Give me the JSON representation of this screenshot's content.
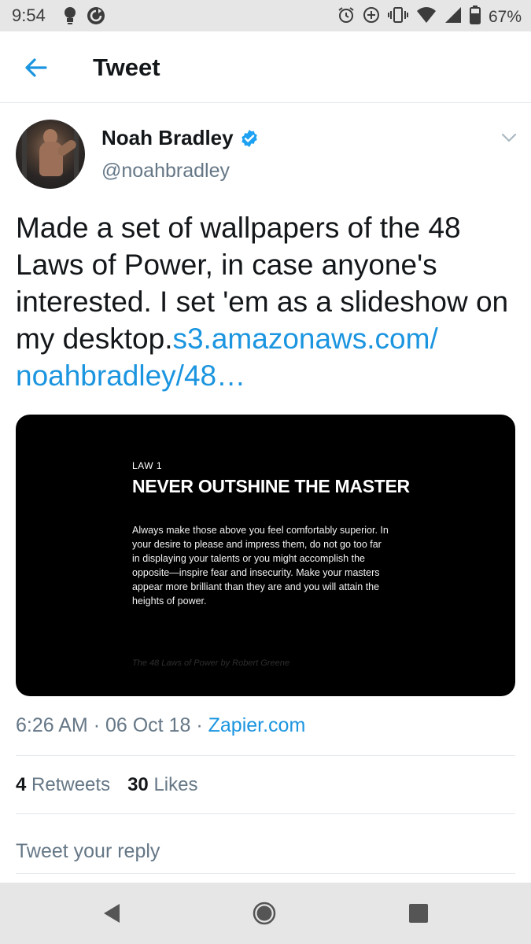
{
  "status_bar": {
    "time": "9:54",
    "battery": "67%",
    "icons": [
      "lightbulb-icon",
      "refresh-icon",
      "alarm-icon",
      "data-saver-icon",
      "vibrate-icon",
      "wifi-icon",
      "signal-icon",
      "battery-icon"
    ]
  },
  "appbar": {
    "title": "Tweet",
    "back_icon": "arrow-left-icon"
  },
  "tweet": {
    "author_name": "Noah Bradley",
    "author_handle": "@noahbradley",
    "text_plain": "Made a set of wallpapers of the 48 Laws of Power, in case anyone's interested. I set 'em as a slideshow on my desktop.",
    "link_text": "s3.amazonaws.com/\nnoahbradley/48…",
    "time": "6:26 AM",
    "date": "06 Oct 18",
    "separator": "·",
    "source": "Zapier.com"
  },
  "media": {
    "law_number": "LAW 1",
    "law_title": "NEVER OUTSHINE THE MASTER",
    "law_body": "Always make those above you feel comfortably superior. In your desire to please and impress them, do not go too far in displaying your talents or you might accomplish the opposite—inspire fear and insecurity. Make your masters appear more brilliant than they are and you will attain the heights of power.",
    "credit": "The 48 Laws of Power by Robert Greene"
  },
  "stats": {
    "retweets_count": "4",
    "retweets_label": "Retweets",
    "likes_count": "30",
    "likes_label": "Likes"
  },
  "reply": {
    "placeholder": "Tweet your reply"
  },
  "colors": {
    "accent": "#1b95e0",
    "text": "#14171a",
    "muted": "#657786",
    "divider": "#e1e8ed",
    "system_bar": "#e6e6e6"
  },
  "navbar": {
    "icons": [
      "back-triangle-icon",
      "home-circle-icon",
      "overview-square-icon"
    ]
  }
}
